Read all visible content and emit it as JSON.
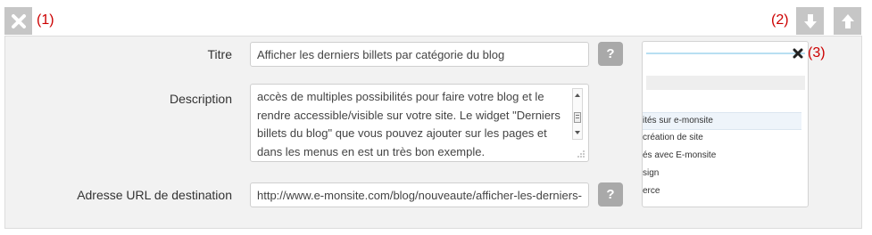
{
  "toolbar": {
    "delete_annotation": "(1)",
    "move_annotation": "(2)",
    "preview_close_annotation": "(3)",
    "delete_icon": "close-icon",
    "move_down_icon": "arrow-down-icon",
    "move_up_icon": "arrow-up-icon"
  },
  "form": {
    "title_label": "Titre",
    "title_value": "Afficher les derniers billets par catégorie du blog",
    "description_label": "Description",
    "description_lines": [
      "accès de multiples possibilités pour faire votre blog et le",
      "rendre accessible/visible sur votre site. Le widget \"Derniers",
      "billets du blog\" que vous pouvez ajouter sur les pages et",
      "dans les menus en est un très bon exemple."
    ],
    "url_label": "Adresse URL de destination",
    "url_value": "http://www.e-monsite.com/blog/nouveaute/afficher-les-derniers-b",
    "help_label": "?"
  },
  "preview": {
    "close_icon": "close-icon",
    "items": [
      "ités sur e-monsite",
      " création de site",
      "és avec E-monsite",
      "sign",
      "erce"
    ]
  },
  "colors": {
    "annotation": "#cc0000",
    "panel_bg": "#f2f2f2",
    "tool_button": "#c6c6c6",
    "help_button": "#a9a9a9"
  }
}
